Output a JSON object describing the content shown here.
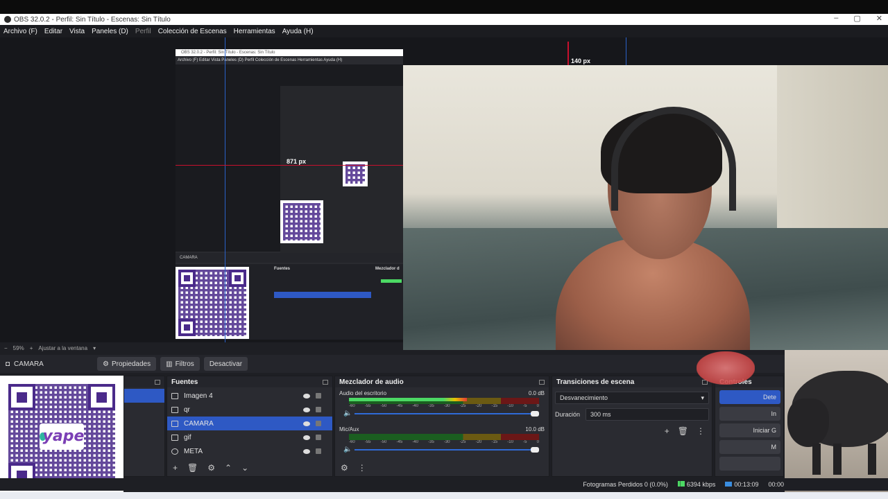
{
  "window": {
    "title": "OBS 32.0.2 - Perfil: Sin Título - Escenas: Sin Título"
  },
  "menu": {
    "items": [
      "Archivo (F)",
      "Editar",
      "Vista",
      "Paneles (D)",
      "Perfil",
      "Colección de Escenas",
      "Herramientas",
      "Ayuda (H)"
    ]
  },
  "preview": {
    "guide_left_label": "871 px",
    "guide_top_label": "140 px",
    "zoom": "59%",
    "fit_label": "Ajustar a la ventana",
    "nested_title": "OBS 32.0.2 - Perfil: Sin Título - Escenas: Sin Título",
    "nested_menu": "Archivo (F)   Editar   Vista   Paneles (D)   Perfil   Colección de Escenas   Herramientas   Ayuda (H)",
    "nested_camera": "CAMARA",
    "nested_fuentes": "Fuentes",
    "nested_mixer": "Mezclador d"
  },
  "source_toolbar": {
    "source_name": "CAMARA",
    "properties_label": "Propiedades",
    "filters_label": "Filtros",
    "deactivate_label": "Desactivar"
  },
  "qr": {
    "brand": "yape"
  },
  "sources": {
    "title": "Fuentes",
    "items": [
      {
        "label": "Imagen 4",
        "selected": false
      },
      {
        "label": "qr",
        "selected": false
      },
      {
        "label": "CAMARA",
        "selected": true
      },
      {
        "label": "gif",
        "selected": false
      },
      {
        "label": "META",
        "selected": false
      }
    ]
  },
  "mixer": {
    "title": "Mezclador de audio",
    "channels": [
      {
        "name": "Audio del escritorio",
        "db": "0.0 dB",
        "level": 0.62
      },
      {
        "name": "Mic/Aux",
        "db": "10.0 dB",
        "level": 0.0
      }
    ],
    "ticks": [
      "-60",
      "-55",
      "-50",
      "-45",
      "-40",
      "-35",
      "-30",
      "-25",
      "-20",
      "-15",
      "-10",
      "-5",
      "0"
    ]
  },
  "transitions": {
    "title": "Transiciones de escena",
    "selected": "Desvanecimiento",
    "duration_label": "Duración",
    "duration_value": "300 ms"
  },
  "controls": {
    "title": "Controles",
    "buttons": [
      "Dete",
      "In",
      "Iniciar G",
      "M",
      ""
    ]
  },
  "status": {
    "dropped_frames": "Fotogramas Perdidos 0 (0.0%)",
    "bitrate": "6394 kbps",
    "time": "00:13:09",
    "rec_time": "00:00"
  },
  "colors": {
    "accent": "#2e59c4",
    "guide_red": "#c8102e",
    "guide_blue": "#2a62c9"
  }
}
